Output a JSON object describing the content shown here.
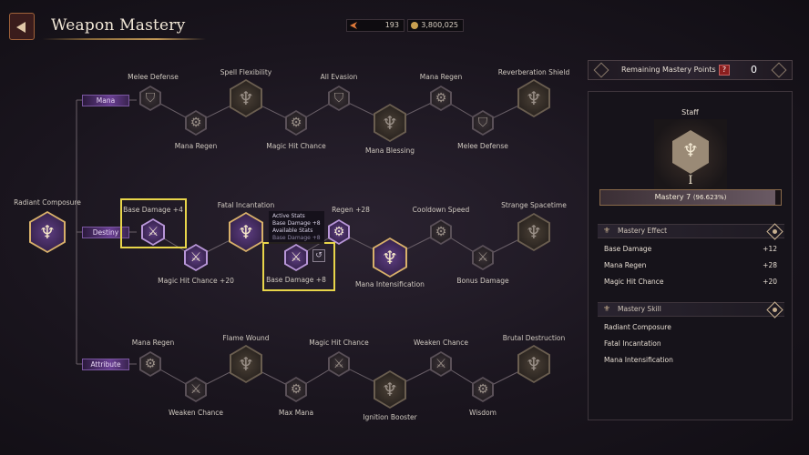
{
  "header": {
    "title": "Weapon Mastery"
  },
  "currency": [
    {
      "icon": "arrow-token-icon",
      "value": "193"
    },
    {
      "icon": "gold-coin-icon",
      "value": "3,800,025"
    }
  ],
  "tracks": {
    "mana": "Mana",
    "destiny": "Destiny",
    "attribute": "Attribute"
  },
  "nodes": {
    "root": "Radiant Composure",
    "mana": [
      "Melee Defense",
      "Mana Regen",
      "Spell Flexibility",
      "Magic Hit Chance",
      "All Evasion",
      "Mana Blessing",
      "Mana Regen",
      "Melee Defense",
      "Reverberation Shield"
    ],
    "destiny": {
      "base_damage_1": "Base Damage  +4",
      "magic_hit_chance": "Magic Hit Chance  +20",
      "fatal_incantation": "Fatal Incantation",
      "regen_partial": "Regen +28",
      "base_damage_2": "Base Damage  +8",
      "mana_intensification": "Mana Intensification",
      "cooldown_speed": "Cooldown Speed",
      "bonus_damage": "Bonus Damage",
      "strange_spacetime": "Strange Spacetime"
    },
    "attribute": [
      "Mana Regen",
      "Weaken Chance",
      "Flame Wound",
      "Max Mana",
      "Magic Hit Chance",
      "Ignition Booster",
      "Weaken Chance",
      "Wisdom",
      "Brutal Destruction"
    ]
  },
  "tooltip": {
    "active": "Active Stats",
    "active_val": "Base Damage  +8",
    "available": "Available Stats",
    "available_val": "Base Damage  +8"
  },
  "panel": {
    "remaining_label": "Remaining Mastery Points",
    "remaining_value": "0",
    "weapon": "Staff",
    "rank": "I",
    "mastery_level": "Mastery 7",
    "mastery_percent": "(96.623%)",
    "mastery_progress": 0.96623,
    "effect_title": "Mastery Effect",
    "effects": [
      {
        "name": "Base Damage",
        "value": "+12"
      },
      {
        "name": "Mana Regen",
        "value": "+28"
      },
      {
        "name": "Magic Hit Chance",
        "value": "+20"
      }
    ],
    "skill_title": "Mastery Skill",
    "skills": [
      "Radiant Composure",
      "Fatal Incantation",
      "Mana Intensification"
    ]
  },
  "colors": {
    "accent": "#b896d8",
    "highlight": "#e8d54a",
    "gold": "#d8b06a"
  }
}
